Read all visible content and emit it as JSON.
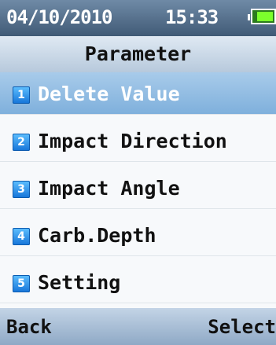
{
  "status": {
    "date": "04/10/2010",
    "time": "15:33",
    "battery_level": 0.85
  },
  "header": {
    "title": "Parameter"
  },
  "menu": {
    "selected_index": 0,
    "items": [
      {
        "number": "1",
        "label": "Delete Value"
      },
      {
        "number": "2",
        "label": "Impact Direction"
      },
      {
        "number": "3",
        "label": "Impact Angle"
      },
      {
        "number": "4",
        "label": "Carb.Depth"
      },
      {
        "number": "5",
        "label": "Setting"
      }
    ]
  },
  "softkeys": {
    "left": "Back",
    "right": "Select"
  },
  "colors": {
    "status_bar": "#405a76",
    "selection": "#8fbbe3",
    "battery_fill": "#7cff2c",
    "badge": "#1d8ae8"
  }
}
